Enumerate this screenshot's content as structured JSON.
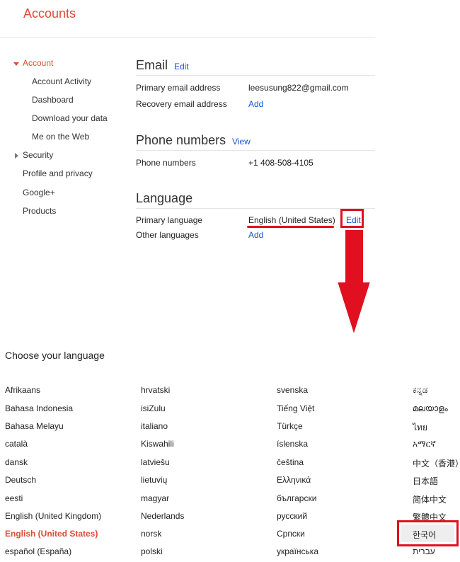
{
  "header": {
    "title": "Accounts"
  },
  "sidebar": {
    "items": [
      {
        "label": "Account"
      },
      {
        "label": "Account Activity"
      },
      {
        "label": "Dashboard"
      },
      {
        "label": "Download your data"
      },
      {
        "label": "Me on the Web"
      },
      {
        "label": "Security"
      },
      {
        "label": "Profile and privacy"
      },
      {
        "label": "Google+"
      },
      {
        "label": "Products"
      }
    ]
  },
  "email": {
    "title": "Email",
    "edit_link": "Edit",
    "primary_label": "Primary email address",
    "primary_value": "leesusung822@gmail.com",
    "recovery_label": "Recovery email address",
    "recovery_link": "Add"
  },
  "phone": {
    "title": "Phone numbers",
    "view_link": "View",
    "label": "Phone numbers",
    "value": "+1 408-508-4105"
  },
  "language": {
    "title": "Language",
    "primary_label": "Primary language",
    "primary_value": "English (United States)",
    "edit_link": "Edit",
    "other_label": "Other languages",
    "other_link": "Add"
  },
  "chooser": {
    "title": "Choose your language",
    "columns": [
      [
        "Afrikaans",
        "Bahasa Indonesia",
        "Bahasa Melayu",
        "català",
        "dansk",
        "Deutsch",
        "eesti",
        "English (United Kingdom)",
        "English (United States)",
        "español (España)"
      ],
      [
        "hrvatski",
        "isiZulu",
        "italiano",
        "Kiswahili",
        "latviešu",
        "lietuvių",
        "magyar",
        "Nederlands",
        "norsk",
        "polski"
      ],
      [
        "svenska",
        "Tiếng Việt",
        "Türkçe",
        "íslenska",
        "čeština",
        "Ελληνικά",
        "български",
        "русский",
        "Српски",
        "українська"
      ],
      [
        "ಕನ್ನಡ",
        "മലയാളം",
        "ไทย",
        "አማርኛ",
        "中文（香港）",
        "日本語",
        "简体中文",
        "繁體中文",
        "한국어",
        "עברית"
      ]
    ],
    "selected": "English (United States)",
    "highlighted": "한국어"
  },
  "annotations": {
    "color": "#e01020"
  },
  "colors": {
    "accent": "#dd4b39",
    "link": "#1155cc"
  }
}
